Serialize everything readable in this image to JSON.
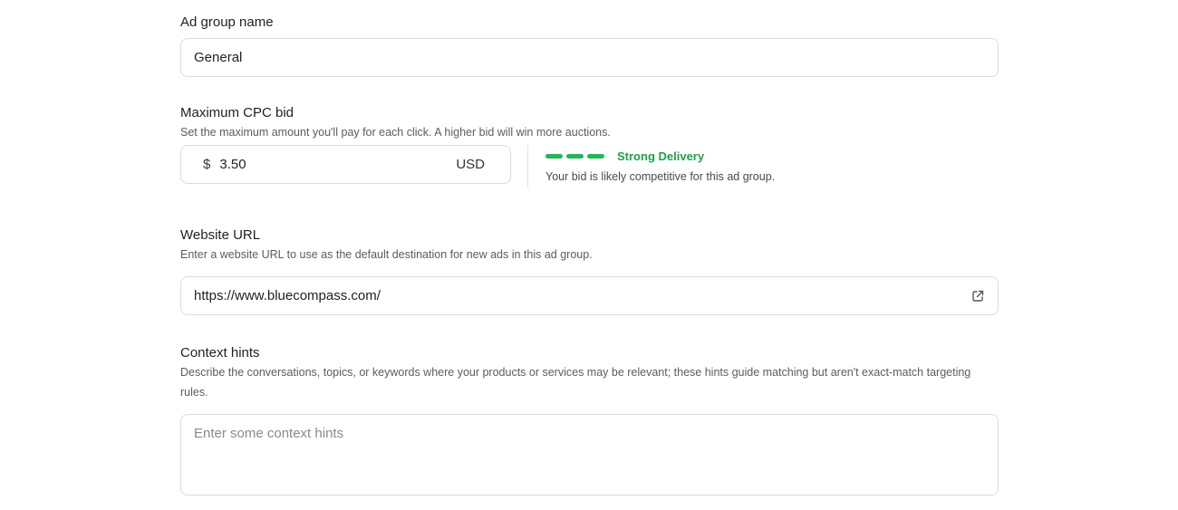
{
  "ad_group_name": {
    "label": "Ad group name",
    "value": "General"
  },
  "max_cpc": {
    "label": "Maximum CPC bid",
    "help": "Set the maximum amount you'll pay for each click. A higher bid will win more auctions.",
    "currency_symbol": "$",
    "value": "3.50",
    "unit": "USD",
    "delivery_status": "Strong Delivery",
    "delivery_note": "Your bid is likely competitive for this ad group.",
    "delivery_color": "#1db954"
  },
  "website_url": {
    "label": "Website URL",
    "help": "Enter a website URL to use as the default destination for new ads in this ad group.",
    "value": "https://www.bluecompass.com/",
    "icon": "external-link-icon"
  },
  "context_hints": {
    "label": "Context hints",
    "help": "Describe the conversations, topics, or keywords where your products or services may be relevant; these hints guide matching but aren't exact-match targeting rules.",
    "placeholder": "Enter some context hints",
    "value": ""
  }
}
